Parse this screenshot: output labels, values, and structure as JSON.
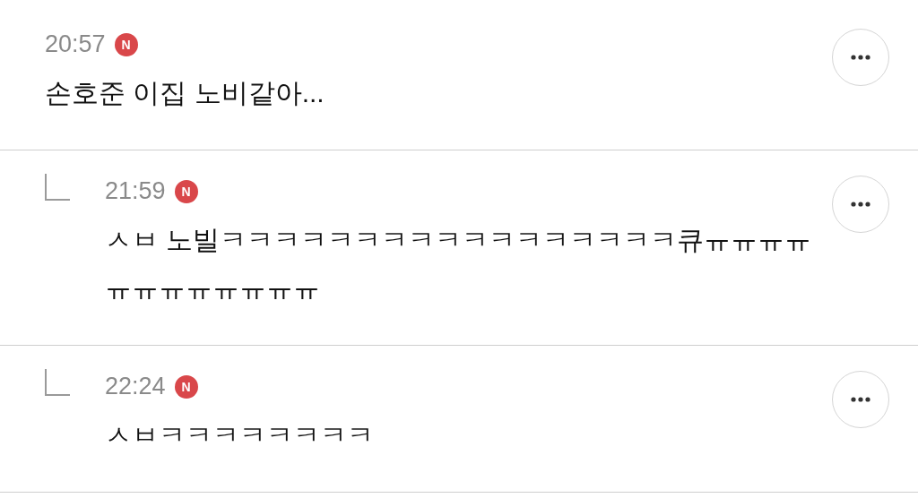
{
  "comments": [
    {
      "kind": "comment",
      "time": "20:57",
      "badge": "N",
      "text": "손호준 이집 노비같아..."
    },
    {
      "kind": "reply",
      "time": "21:59",
      "badge": "N",
      "text": "ㅅㅂ 노빌ㅋㅋㅋㅋㅋㅋㅋㅋㅋㅋㅋㅋㅋㅋㅋㅋㅋ큐ㅠㅠㅠㅠㅠㅠㅠㅠㅠㅠㅠㅠ"
    },
    {
      "kind": "reply",
      "time": "22:24",
      "badge": "N",
      "text": "ㅅㅂㅋㅋㅋㅋㅋㅋㅋㅋ"
    }
  ]
}
